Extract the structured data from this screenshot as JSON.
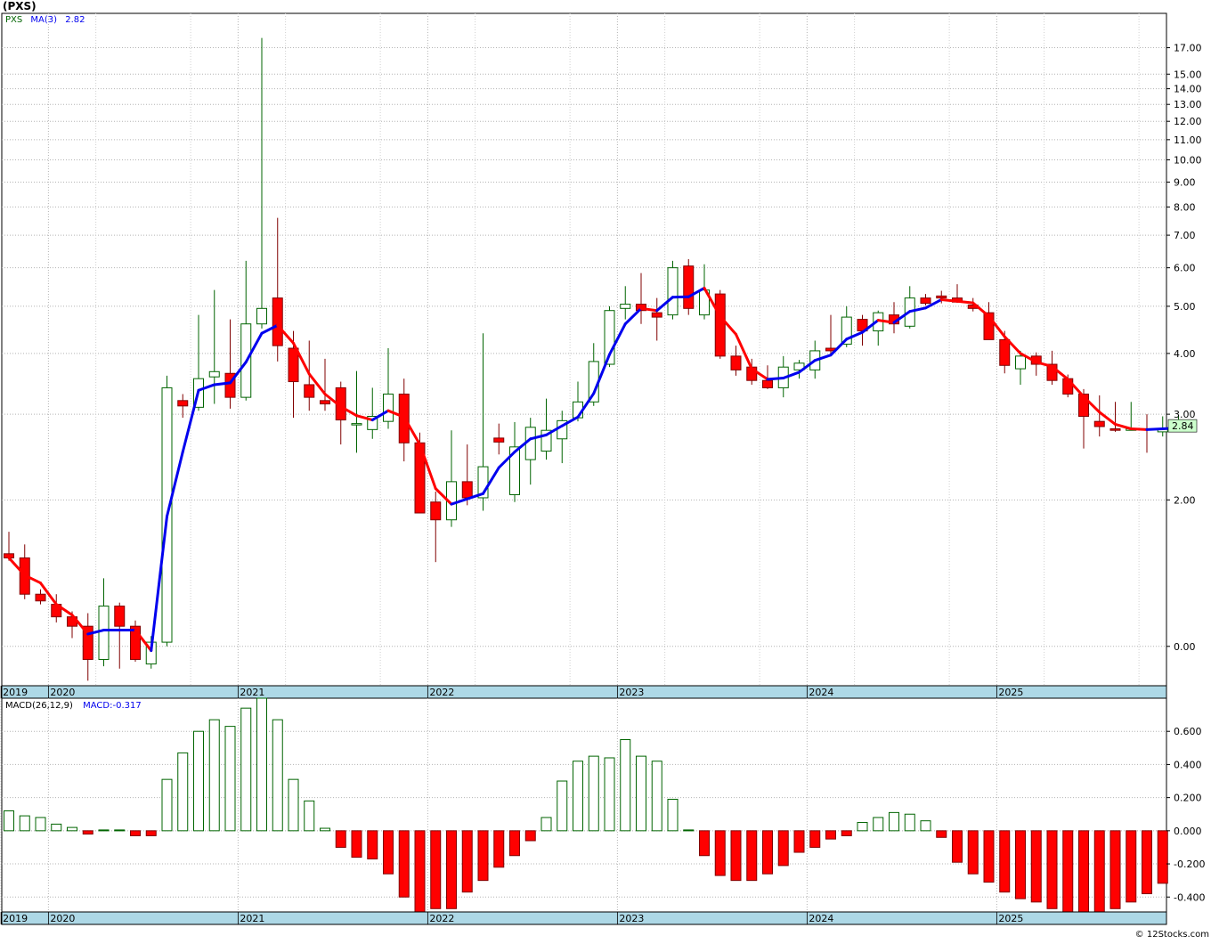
{
  "title": "(PXS)",
  "footer": "© 12Stocks.com",
  "colors": {
    "up": "#006400",
    "down": "#ff0000",
    "ma_up": "#0000ee",
    "ma_down": "#ff0000",
    "grid": "#b4b4b4",
    "axis_band": "#add8e6",
    "last_label_bg": "#ccffcc"
  },
  "chart_data": [
    {
      "type": "candlestick",
      "panel": "price",
      "legend": [
        {
          "text": "PXS",
          "color": "#006400"
        },
        {
          "text": "MA(3)",
          "color": "#0000ee"
        },
        {
          "text": "2.82",
          "color": "#0000ee"
        }
      ],
      "scale": "log",
      "ylim": [
        0.83,
        20.0
      ],
      "yticks": [
        17,
        15,
        14,
        13,
        12,
        11,
        10,
        9,
        8,
        7,
        6,
        5,
        4,
        3,
        2,
        1
      ],
      "ytick_labels": [
        "17.00",
        "15.00",
        "14.00",
        "13.00",
        "12.00",
        "11.00",
        "10.00",
        "9.00",
        "8.00",
        "7.00",
        "6.00",
        "5.00",
        "4.00",
        "3.00",
        "2.00",
        "0.00"
      ],
      "x_start": "2019-11",
      "x_labels": [
        {
          "index": 0,
          "label": "2019"
        },
        {
          "index": 3,
          "label": "2020"
        },
        {
          "index": 15,
          "label": "2021"
        },
        {
          "index": 27,
          "label": "2022"
        },
        {
          "index": 39,
          "label": "2023"
        },
        {
          "index": 51,
          "label": "2024"
        },
        {
          "index": 63,
          "label": "2025"
        }
      ],
      "last_value": "2.84",
      "ohlc": [
        [
          1.55,
          1.72,
          1.5,
          1.52
        ],
        [
          1.52,
          1.62,
          1.25,
          1.28
        ],
        [
          1.28,
          1.31,
          1.22,
          1.24
        ],
        [
          1.22,
          1.28,
          1.12,
          1.15
        ],
        [
          1.15,
          1.18,
          1.04,
          1.1
        ],
        [
          1.1,
          1.17,
          0.85,
          0.94
        ],
        [
          0.94,
          1.38,
          0.91,
          1.21
        ],
        [
          1.21,
          1.23,
          0.9,
          1.1
        ],
        [
          1.1,
          1.13,
          0.93,
          0.94
        ],
        [
          0.92,
          1.05,
          0.9,
          1.02
        ],
        [
          1.02,
          3.6,
          1.0,
          3.4
        ],
        [
          3.2,
          3.3,
          2.95,
          3.12
        ],
        [
          3.1,
          4.8,
          3.05,
          3.55
        ],
        [
          3.58,
          5.4,
          3.15,
          3.67
        ],
        [
          3.64,
          4.7,
          3.08,
          3.25
        ],
        [
          3.25,
          6.2,
          3.2,
          4.6
        ],
        [
          4.6,
          17.8,
          4.5,
          4.95
        ],
        [
          5.2,
          7.6,
          3.85,
          4.15
        ],
        [
          4.1,
          4.45,
          2.95,
          3.5
        ],
        [
          3.45,
          4.25,
          3.05,
          3.25
        ],
        [
          3.2,
          3.9,
          3.05,
          3.15
        ],
        [
          3.4,
          3.5,
          2.6,
          2.92
        ],
        [
          2.87,
          3.68,
          2.5,
          2.87
        ],
        [
          2.79,
          3.4,
          2.67,
          2.97
        ],
        [
          2.9,
          4.1,
          2.8,
          3.3
        ],
        [
          3.3,
          3.55,
          2.4,
          2.62
        ],
        [
          2.62,
          2.75,
          1.88,
          1.88
        ],
        [
          1.98,
          2.08,
          1.49,
          1.82
        ],
        [
          1.82,
          2.78,
          1.76,
          2.18
        ],
        [
          2.18,
          2.6,
          1.95,
          2.02
        ],
        [
          2.02,
          4.4,
          1.9,
          2.34
        ],
        [
          2.68,
          2.87,
          2.48,
          2.63
        ],
        [
          2.05,
          2.89,
          1.98,
          2.57
        ],
        [
          2.42,
          2.95,
          2.15,
          2.82
        ],
        [
          2.52,
          3.23,
          2.42,
          2.78
        ],
        [
          2.67,
          3.05,
          2.38,
          2.91
        ],
        [
          2.95,
          3.5,
          2.9,
          3.18
        ],
        [
          3.18,
          4.2,
          3.12,
          3.85
        ],
        [
          3.8,
          5.0,
          3.75,
          4.9
        ],
        [
          4.95,
          5.5,
          4.7,
          5.05
        ],
        [
          5.05,
          5.85,
          4.6,
          4.9
        ],
        [
          4.85,
          5.2,
          4.25,
          4.75
        ],
        [
          4.8,
          6.2,
          4.7,
          6.0
        ],
        [
          6.05,
          6.25,
          4.8,
          4.95
        ],
        [
          4.8,
          6.1,
          4.7,
          5.4
        ],
        [
          5.3,
          5.4,
          3.9,
          3.95
        ],
        [
          3.95,
          4.15,
          3.6,
          3.7
        ],
        [
          3.75,
          3.9,
          3.45,
          3.52
        ],
        [
          3.52,
          3.78,
          3.38,
          3.4
        ],
        [
          3.4,
          3.95,
          3.25,
          3.75
        ],
        [
          3.7,
          3.88,
          3.55,
          3.82
        ],
        [
          3.7,
          4.25,
          3.55,
          4.05
        ],
        [
          4.1,
          4.8,
          3.95,
          4.05
        ],
        [
          4.18,
          5.0,
          4.12,
          4.75
        ],
        [
          4.7,
          4.8,
          4.15,
          4.45
        ],
        [
          4.45,
          4.9,
          4.15,
          4.85
        ],
        [
          4.8,
          5.1,
          4.4,
          4.6
        ],
        [
          4.55,
          5.5,
          4.5,
          5.2
        ],
        [
          5.2,
          5.3,
          5.02,
          5.07
        ],
        [
          5.25,
          5.38,
          5.07,
          5.2
        ],
        [
          5.2,
          5.55,
          5.08,
          5.1
        ],
        [
          5.03,
          5.2,
          4.88,
          4.95
        ],
        [
          4.85,
          5.1,
          4.35,
          4.27
        ],
        [
          4.27,
          4.45,
          3.64,
          3.78
        ],
        [
          3.72,
          4.05,
          3.45,
          3.95
        ],
        [
          3.95,
          4.02,
          3.6,
          3.8
        ],
        [
          3.8,
          4.05,
          3.45,
          3.52
        ],
        [
          3.55,
          3.62,
          3.25,
          3.3
        ],
        [
          3.3,
          3.38,
          2.55,
          2.97
        ],
        [
          2.9,
          3.28,
          2.7,
          2.83
        ],
        [
          2.8,
          3.18,
          2.76,
          2.78
        ],
        [
          2.78,
          3.18,
          2.78,
          2.8
        ],
        [
          2.8,
          3.0,
          2.5,
          2.79
        ],
        [
          2.76,
          2.97,
          2.7,
          2.8
        ],
        [
          2.8,
          2.99,
          2.77,
          2.84
        ]
      ],
      "ma3": [
        1.52,
        1.4,
        1.35,
        1.22,
        1.16,
        1.06,
        1.08,
        1.08,
        1.08,
        0.98,
        1.85,
        2.51,
        3.36,
        3.45,
        3.48,
        3.84,
        4.4,
        4.57,
        4.2,
        3.63,
        3.3,
        3.11,
        2.98,
        2.92,
        3.05,
        2.96,
        2.6,
        2.11,
        1.96,
        2.01,
        2.06,
        2.33,
        2.51,
        2.67,
        2.72,
        2.84,
        2.96,
        3.31,
        3.98,
        4.6,
        4.95,
        4.9,
        5.22,
        5.23,
        5.45,
        4.77,
        4.38,
        3.72,
        3.54,
        3.56,
        3.66,
        3.87,
        3.97,
        4.28,
        4.42,
        4.68,
        4.63,
        4.88,
        4.96,
        5.16,
        5.12,
        5.08,
        4.77,
        4.33,
        4.0,
        3.84,
        3.76,
        3.54,
        3.26,
        3.03,
        2.86,
        2.8,
        2.79,
        2.8,
        2.81
      ]
    },
    {
      "type": "bar",
      "panel": "macd",
      "legend": [
        {
          "text": "MACD(26,12,9)",
          "color": "#000000"
        },
        {
          "text": "MACD:-0.317",
          "color": "#0000ee"
        }
      ],
      "ylim": [
        -0.49,
        0.8
      ],
      "yticks": [
        0.6,
        0.4,
        0.2,
        0.0,
        -0.2,
        -0.4
      ],
      "ytick_labels": [
        "0.600",
        "0.400",
        "0.200",
        "0.000",
        "-0.200",
        "-0.400"
      ],
      "values": [
        0.12,
        0.09,
        0.08,
        0.04,
        0.02,
        -0.02,
        0.005,
        0.005,
        -0.03,
        -0.03,
        0.31,
        0.47,
        0.6,
        0.67,
        0.63,
        0.74,
        0.8,
        0.67,
        0.31,
        0.18,
        0.015,
        -0.1,
        -0.16,
        -0.17,
        -0.26,
        -0.4,
        -0.49,
        -0.47,
        -0.47,
        -0.37,
        -0.3,
        -0.22,
        -0.15,
        -0.06,
        0.08,
        0.3,
        0.42,
        0.45,
        0.44,
        0.55,
        0.45,
        0.42,
        0.19,
        0.005,
        -0.15,
        -0.27,
        -0.3,
        -0.3,
        -0.26,
        -0.21,
        -0.13,
        -0.1,
        -0.05,
        -0.03,
        0.05,
        0.08,
        0.11,
        0.1,
        0.06,
        -0.04,
        -0.19,
        -0.26,
        -0.31,
        -0.37,
        -0.41,
        -0.43,
        -0.47,
        -0.49,
        -0.51,
        -0.49,
        -0.47,
        -0.43,
        -0.38,
        -0.317
      ]
    }
  ]
}
